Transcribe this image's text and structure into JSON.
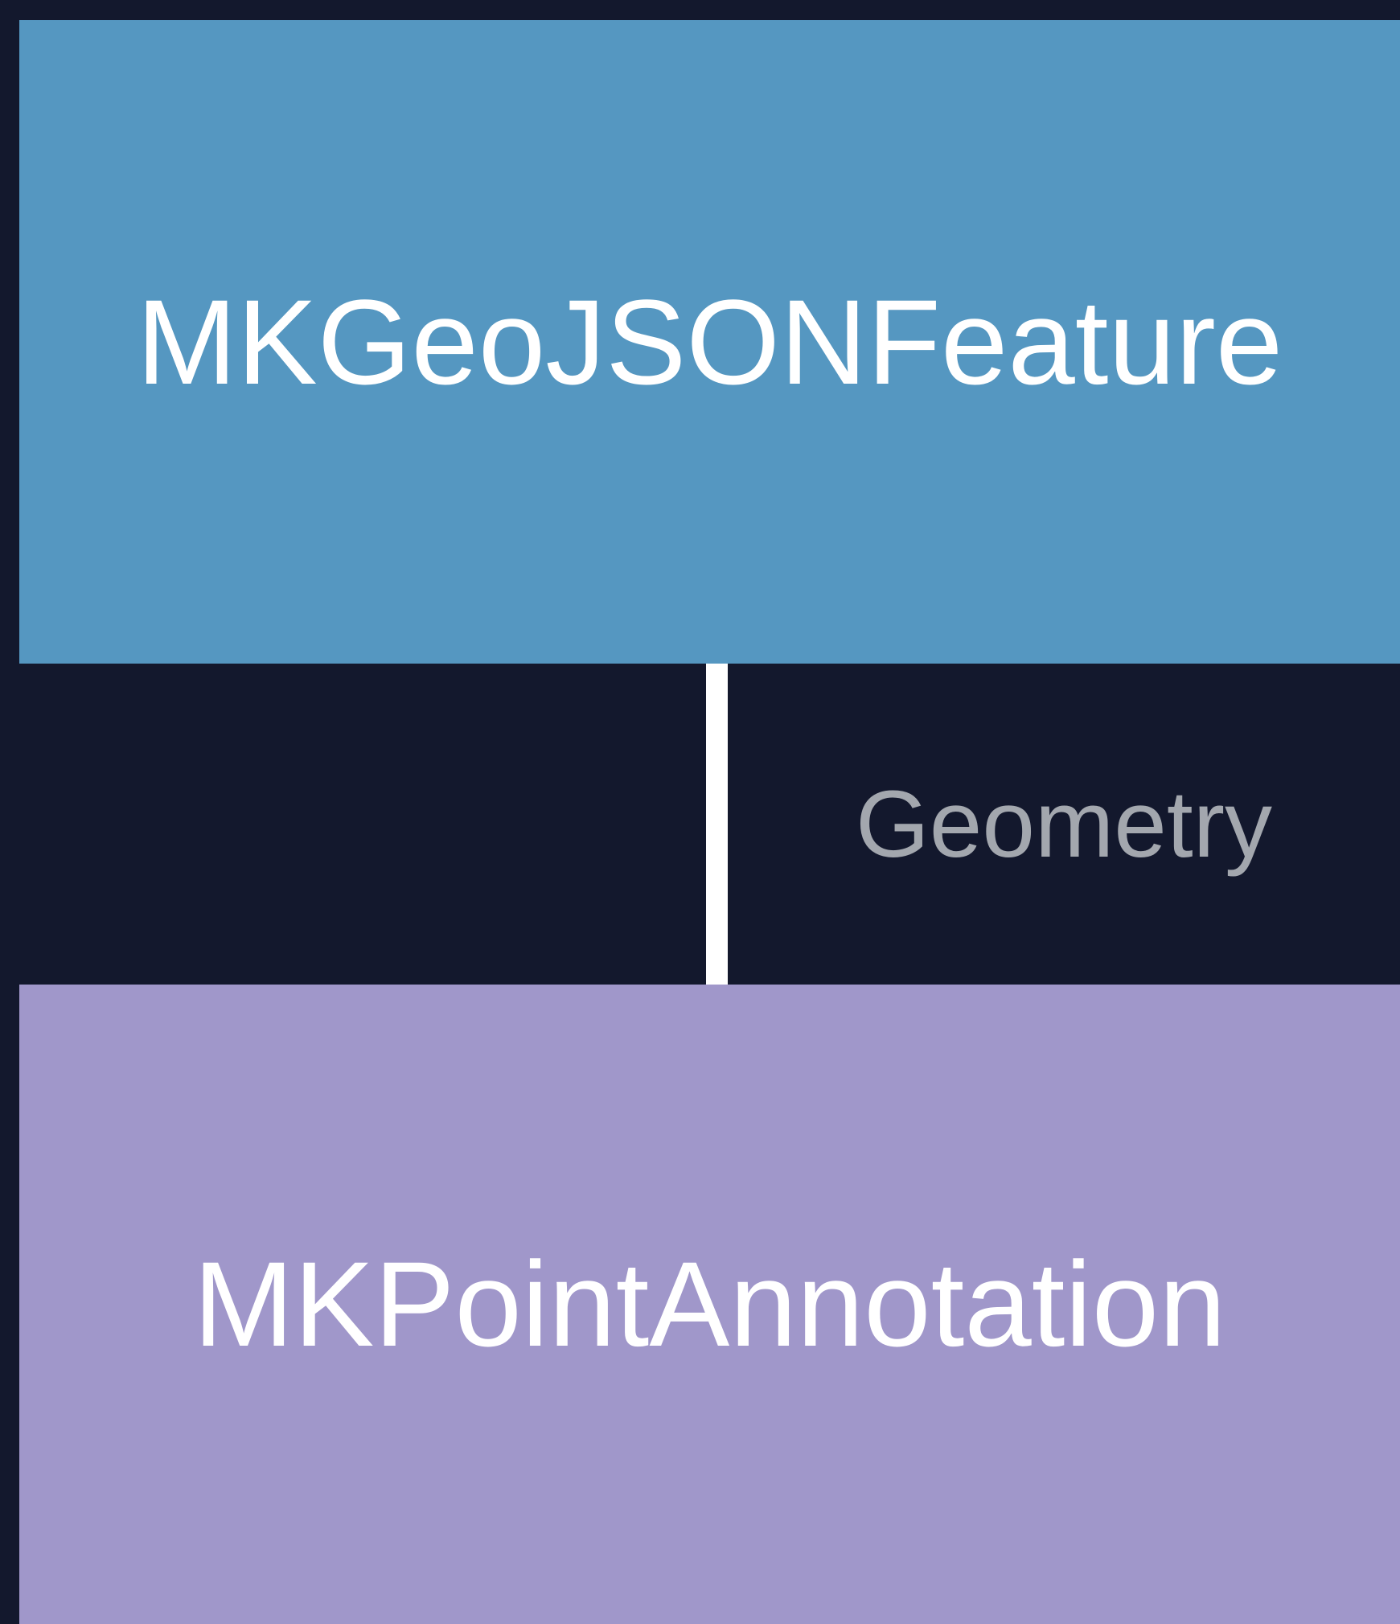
{
  "diagram": {
    "parent_node": {
      "label": "MKGeoJSONFeature",
      "color": "#5597c1"
    },
    "relationship": {
      "label": "Geometry",
      "color": "#a3a7ae"
    },
    "child_node": {
      "label": "MKPointAnnotation",
      "color": "#a097ca"
    },
    "background_color": "#13182d"
  }
}
